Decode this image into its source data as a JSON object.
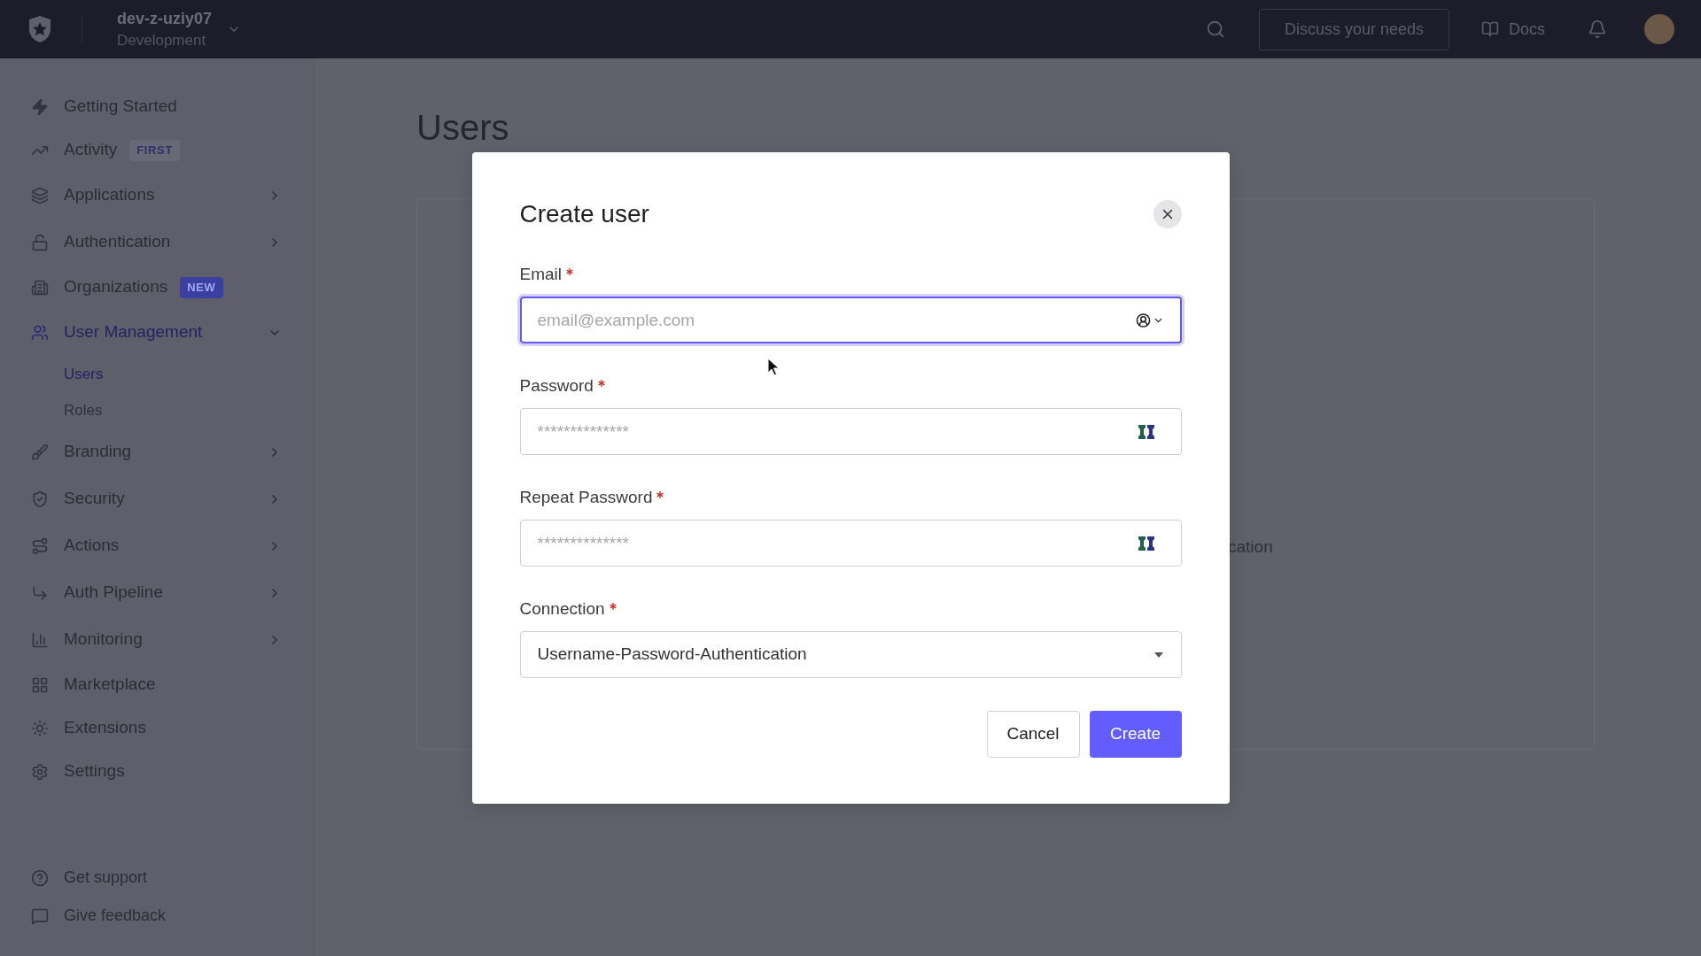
{
  "top_bar": {
    "tenant": {
      "name": "dev-z-uziy07",
      "environment": "Development"
    },
    "discuss_button": "Discuss your needs",
    "docs_link": "Docs"
  },
  "sidebar": {
    "items": [
      {
        "label": "Getting Started",
        "selected": false
      },
      {
        "label": "Activity",
        "selected": false,
        "badge": {
          "text": "FIRST",
          "kind": "subtle"
        }
      },
      {
        "label": "Applications",
        "selected": false,
        "expanded": false
      },
      {
        "label": "Authentication",
        "selected": false,
        "expanded": false
      },
      {
        "label": "Organizations",
        "selected": false,
        "badge": {
          "text": "NEW",
          "kind": "accent"
        }
      },
      {
        "label": "User Management",
        "selected": true,
        "expanded": true,
        "children": [
          {
            "label": "Users",
            "selected": true
          },
          {
            "label": "Roles",
            "selected": false
          }
        ]
      },
      {
        "label": "Branding",
        "selected": false,
        "expanded": false
      },
      {
        "label": "Security",
        "selected": false,
        "expanded": false
      },
      {
        "label": "Actions",
        "selected": false,
        "expanded": false
      },
      {
        "label": "Auth Pipeline",
        "selected": false,
        "expanded": false
      },
      {
        "label": "Monitoring",
        "selected": false,
        "expanded": false
      },
      {
        "label": "Marketplace",
        "selected": false
      },
      {
        "label": "Extensions",
        "selected": false
      },
      {
        "label": "Settings",
        "selected": false
      }
    ],
    "footer_items": [
      {
        "label": "Get support"
      },
      {
        "label": "Give feedback"
      }
    ]
  },
  "page": {
    "title": "Users",
    "card_text": "cation"
  },
  "dialog": {
    "title": "Create user",
    "fields": [
      {
        "label": "Email",
        "required": true,
        "kind": "email",
        "placeholder": "email@example.com",
        "focused": true
      },
      {
        "label": "Password",
        "required": true,
        "kind": "password",
        "placeholder": "**************",
        "focused": false
      },
      {
        "label": "Repeat Password",
        "required": true,
        "kind": "password",
        "placeholder": "**************",
        "focused": false
      },
      {
        "label": "Connection",
        "required": true,
        "kind": "select",
        "value": "Username-Password-Authentication",
        "focused": false
      }
    ],
    "buttons": [
      {
        "label": "Cancel",
        "kind": "secondary"
      },
      {
        "label": "Create",
        "kind": "primary"
      }
    ]
  }
}
